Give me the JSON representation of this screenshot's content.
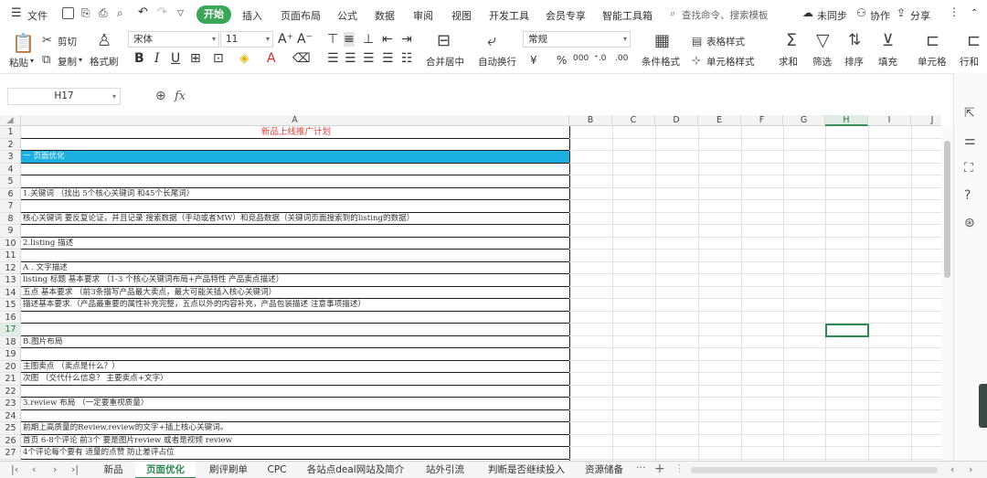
{
  "menu": {
    "file": "文件",
    "tabs": [
      "开始",
      "插入",
      "页面布局",
      "公式",
      "数据",
      "审阅",
      "视图",
      "开发工具",
      "会员专享",
      "智能工具箱"
    ],
    "search_placeholder": "查找命令、搜索模板",
    "sync": "未同步",
    "collab": "协作",
    "share": "分享"
  },
  "ribbon": {
    "paste": "粘贴",
    "cut": "剪切",
    "copy": "复制",
    "format_painter": "格式刷",
    "font_name": "宋体",
    "font_size": "11",
    "merge_center": "合并居中",
    "auto_wrap": "自动换行",
    "number_format": "常规",
    "table_style": "表格样式",
    "cond_format": "条件格式",
    "cell_style": "单元格样式",
    "sum": "求和",
    "filter": "筛选",
    "sort": "排序",
    "fill": "填充",
    "cells": "单元格",
    "rows_cols": "行和"
  },
  "formula_bar": {
    "cell_ref": "H17",
    "fx": "fx",
    "value": ""
  },
  "columns": [
    "A",
    "B",
    "C",
    "D",
    "E",
    "F",
    "G",
    "H",
    "I",
    "J"
  ],
  "selected_column": "H",
  "selected_row": "17",
  "rows": [
    {
      "n": "1",
      "text": "新品上线推广计划",
      "style": "title"
    },
    {
      "n": "2",
      "text": ""
    },
    {
      "n": "3",
      "text": "一  页面优化",
      "style": "blue"
    },
    {
      "n": "4",
      "text": ""
    },
    {
      "n": "5",
      "text": ""
    },
    {
      "n": "6",
      "text": "1.关键词 （找出 5个核心关键词 和45个长尾词）"
    },
    {
      "n": "7",
      "text": ""
    },
    {
      "n": "8",
      "text": "核心关键词 要反复论证，并且记录 搜索数据（手动或者MW）和竞品数据（关键词页面搜索到的listing的数据）"
    },
    {
      "n": "9",
      "text": ""
    },
    {
      "n": "10",
      "text": "2.listing 描述"
    },
    {
      "n": "11",
      "text": ""
    },
    {
      "n": "12",
      "text": "A . 文字描述"
    },
    {
      "n": "13",
      "text": "listing 标题  基本要求 （1-3 个核心关键词布局+产品特性 产品卖点描述）"
    },
    {
      "n": "14",
      "text": "五点  基本要求    （前3条描写产品最大卖点，最大可能关插入核心关键词）"
    },
    {
      "n": "15",
      "text": "描述基本要求   （产品最重要的属性补充完整，五点以外的内容补充，产品包装描述 注意事项描述）"
    },
    {
      "n": "16",
      "text": ""
    },
    {
      "n": "17",
      "text": ""
    },
    {
      "n": "18",
      "text": "B.图片布局"
    },
    {
      "n": "19",
      "text": ""
    },
    {
      "n": "20",
      "text": "主图卖点 （卖点是什么？）"
    },
    {
      "n": "21",
      "text": "次图 （交代什么信息？  主要卖点+文字）"
    },
    {
      "n": "22",
      "text": ""
    },
    {
      "n": "23",
      "text": "3.review 布局 （一定要重视质量）"
    },
    {
      "n": "24",
      "text": ""
    },
    {
      "n": "25",
      "text": "前期上高质量的Review,review的文字+插上核心关键词。"
    },
    {
      "n": "26",
      "text": "首页 6-8个评论 前3个 要是图片review 或者是视频 review"
    },
    {
      "n": "27",
      "text": "4个评论每个要有 适量的点赞 防止差评占位"
    }
  ],
  "sheet_tabs": [
    "新品",
    "页面优化",
    "刷评刷单",
    "CPC",
    "各站点deal网站及简介",
    "站外引流",
    "判断是否继续投入",
    "资源储备"
  ],
  "active_sheet": "页面优化",
  "colors": {
    "accent": "#2f8a4f",
    "start_tab": "#3aa657",
    "section_fill": "#1bb0e0",
    "title_red": "#e0413c"
  }
}
